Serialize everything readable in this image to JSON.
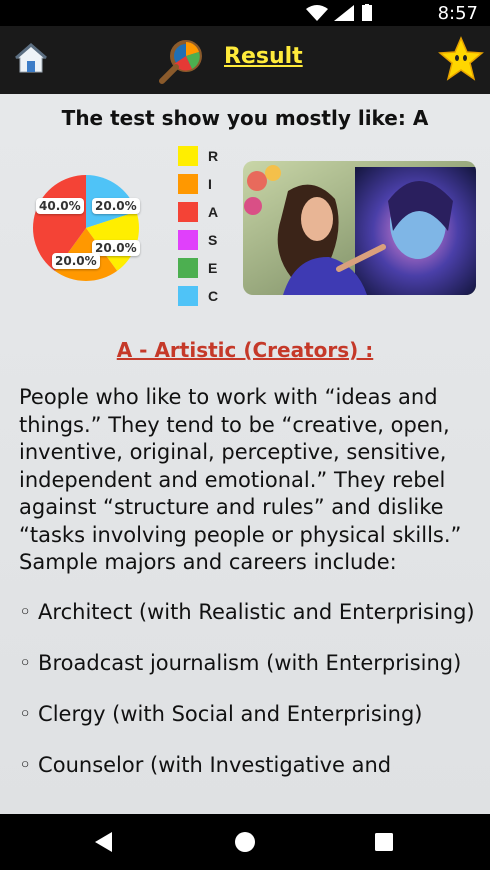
{
  "status_bar": {
    "time": "8:57"
  },
  "app_bar": {
    "title": "Result"
  },
  "headline": "The test show you mostly like: A",
  "chart_data": {
    "type": "pie",
    "slices": [
      {
        "label": "A",
        "value": 40.0,
        "display": "40.0%",
        "color": "#f44336"
      },
      {
        "label": "C",
        "value": 20.0,
        "display": "20.0%",
        "color": "#4fc3f7"
      },
      {
        "label": "R",
        "value": 20.0,
        "display": "20.0%",
        "color": "#ffee00"
      },
      {
        "label": "I",
        "value": 20.0,
        "display": "20.0%",
        "color": "#ff9800"
      }
    ],
    "legend": [
      {
        "letter": "R",
        "color": "#ffee00"
      },
      {
        "letter": "I",
        "color": "#ff9800"
      },
      {
        "letter": "A",
        "color": "#f44336"
      },
      {
        "letter": "S",
        "color": "#e040fb"
      },
      {
        "letter": "E",
        "color": "#4caf50"
      },
      {
        "letter": "C",
        "color": "#4fc3f7"
      }
    ]
  },
  "section_title": "A - Artistic (Creators) :",
  "description": "People who like to work with “ideas and things.” They tend to be “creative, open, inventive, original, perceptive, sensitive, independent and emotional.” They rebel against “structure and rules” and dislike “tasks involving people or physical skills.” Sample majors and careers include:",
  "careers": [
    "◦ Architect (with Realistic and Enterprising)",
    "◦ Broadcast journalism (with Enterprising)",
    "◦ Clergy (with Social and Enterprising)",
    "◦ Counselor (with Investigative and"
  ],
  "icons": {
    "home": "home-icon",
    "search": "magnifier-chart-icon",
    "star": "star-icon",
    "back": "back-icon",
    "home_nav": "home-circle-icon",
    "recents": "recents-square-icon"
  }
}
